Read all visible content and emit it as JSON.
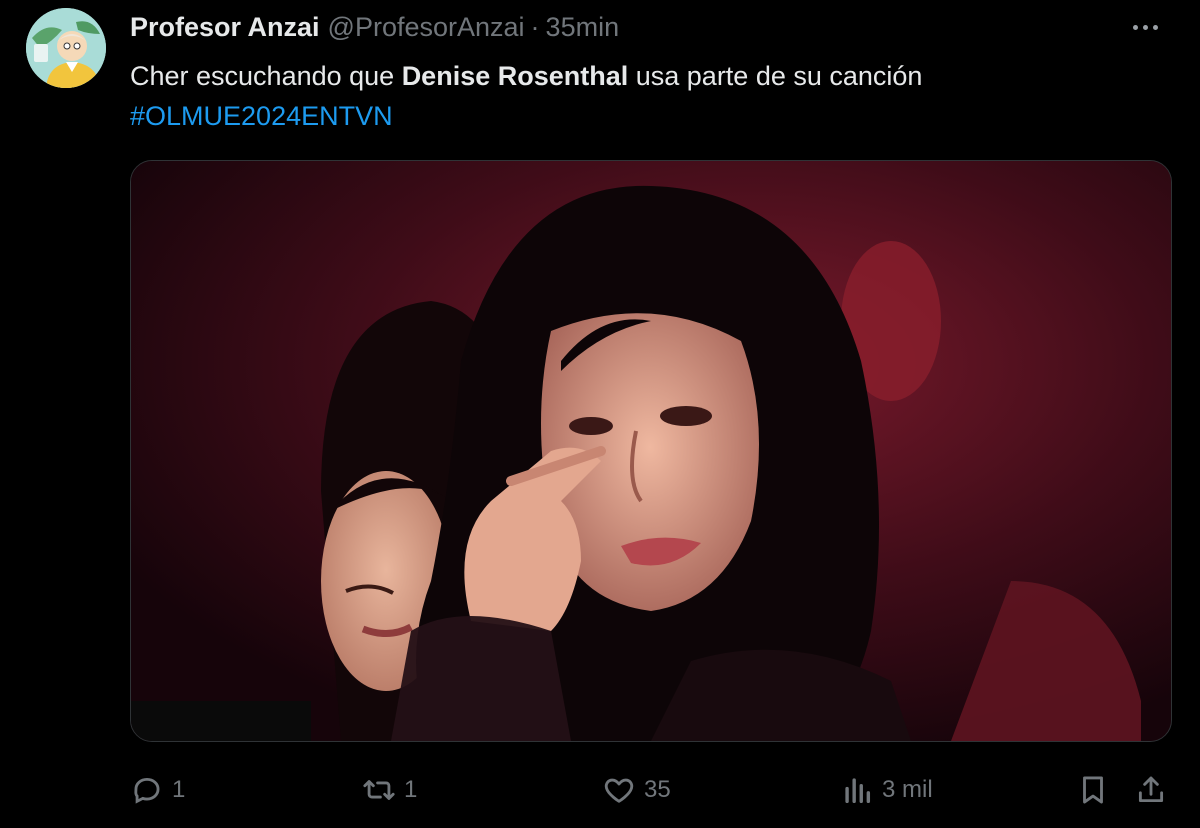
{
  "tweet": {
    "display_name": "Profesor Anzai",
    "handle": "@ProfesorAnzai",
    "separator": "·",
    "time": "35min",
    "text_before": "Cher escuchando que ",
    "text_bold": "Denise Rosenthal",
    "text_after": " usa parte de su canción",
    "hashtag": "#OLMUE2024ENTVN"
  },
  "actions": {
    "replies": "1",
    "retweets": "1",
    "likes": "35",
    "views": "3 mil"
  },
  "icons": {
    "avatar": "avatar-illustration",
    "more": "more-icon",
    "reply": "reply-icon",
    "retweet": "retweet-icon",
    "like": "heart-icon",
    "views": "views-icon",
    "bookmark": "bookmark-icon",
    "share": "share-icon"
  },
  "colors": {
    "background": "#000000",
    "text": "#e7e9ea",
    "muted": "#71767b",
    "link": "#1d9bf0"
  }
}
